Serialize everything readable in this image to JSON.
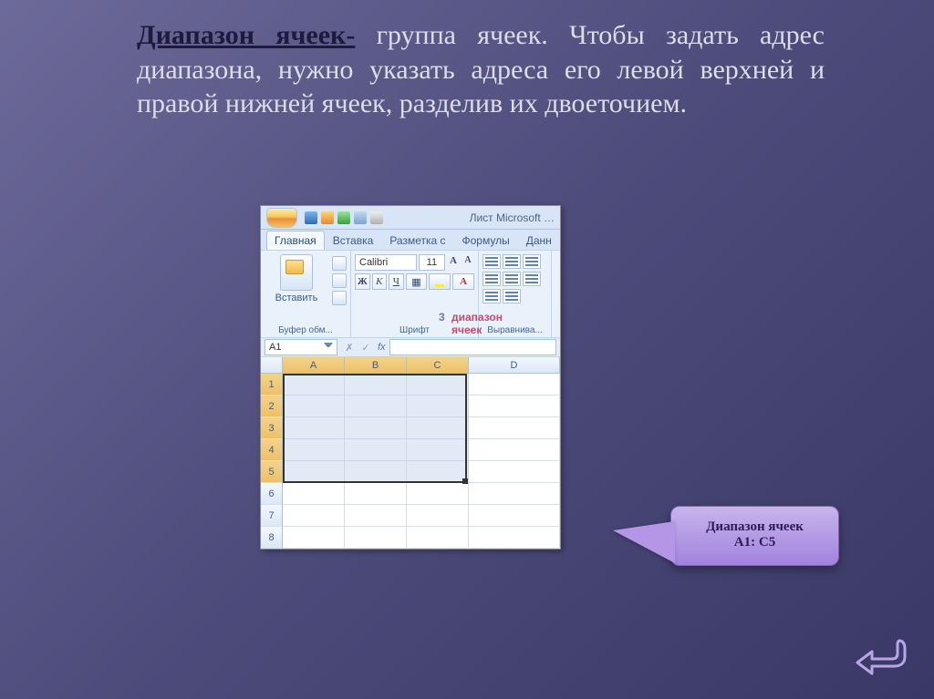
{
  "paragraph": {
    "term": "Диапазон ячеек-",
    "body": " группа ячеек. Чтобы задать адрес диапазона, нужно указать адреса его левой верхней и правой нижней ячеек, разделив их двоеточием."
  },
  "excel": {
    "doc_title": "Лист Microsoft …",
    "tabs": [
      "Главная",
      "Вставка",
      "Разметка с",
      "Формулы",
      "Данн"
    ],
    "active_tab_index": 0,
    "ribbon_groups": {
      "clipboard": {
        "paste_label": "Вставить",
        "group_label": "Буфер обм..."
      },
      "font": {
        "font_name": "Calibri",
        "font_size": "11",
        "group_label": "Шрифт"
      },
      "alignment": {
        "group_label": "Выравнива..."
      }
    },
    "overlay": {
      "num": "3",
      "text": "диапазон ячеек"
    },
    "name_box": "A1",
    "fx_label": "fx",
    "columns": [
      "A",
      "B",
      "C",
      "D"
    ],
    "rows": [
      "1",
      "2",
      "3",
      "4",
      "5",
      "6",
      "7",
      "8"
    ],
    "selection": {
      "start": "A1",
      "end": "C5"
    }
  },
  "callout": {
    "line1": "Диапазон ячеек",
    "line2": "А1: С5"
  }
}
